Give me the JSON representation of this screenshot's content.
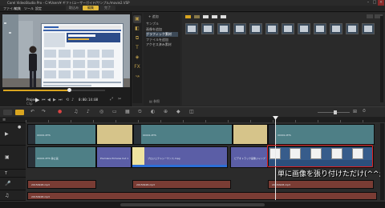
{
  "window": {
    "title": "Corel VideoStudio Pro - C:¥Users¥ ギフト/ユーザーガイド/サンプル/movie2.VSP"
  },
  "menu": [
    "ファイル",
    "編集",
    "ツール",
    "設定"
  ],
  "steps": {
    "capture": "取込み",
    "edit": "編集",
    "share": "完了"
  },
  "player": {
    "mode_project": "Project",
    "mode_clip": "Clip",
    "timecode": "0:00:14:08"
  },
  "library": {
    "folders": [
      "サンプル",
      "画像を追加",
      "グラフィック素材",
      "ファイルを追加",
      "アクセス済み素材"
    ],
    "selected_index": 2,
    "add_label": "追加",
    "browse_label": "参照",
    "thumb_count": 12
  },
  "timeline": {
    "clips": {
      "video_top": [
        "00001.MTS",
        "00001.MTS",
        "00001.MTS"
      ],
      "overlay": [
        "00001.MTS 静止画",
        "Premiere Pictures Cut 1",
        "プロジェクトシーケンス.mpg",
        "ビデオトラック画像ジャンプ"
      ],
      "audio": [
        "20150928.mp3",
        "20150928.mp3",
        "20150928.mp3",
        "20150928.mp3"
      ]
    }
  },
  "annotation": {
    "text": "単に画像を張り付けただけ(^^;"
  },
  "colors": {
    "accent": "#d9a520",
    "annotation_border": "#e02020",
    "clip_teal": "#4e7f86",
    "clip_tan": "#d6c48a",
    "clip_purple": "#5b5ea6",
    "clip_audio": "#7a3c34"
  }
}
